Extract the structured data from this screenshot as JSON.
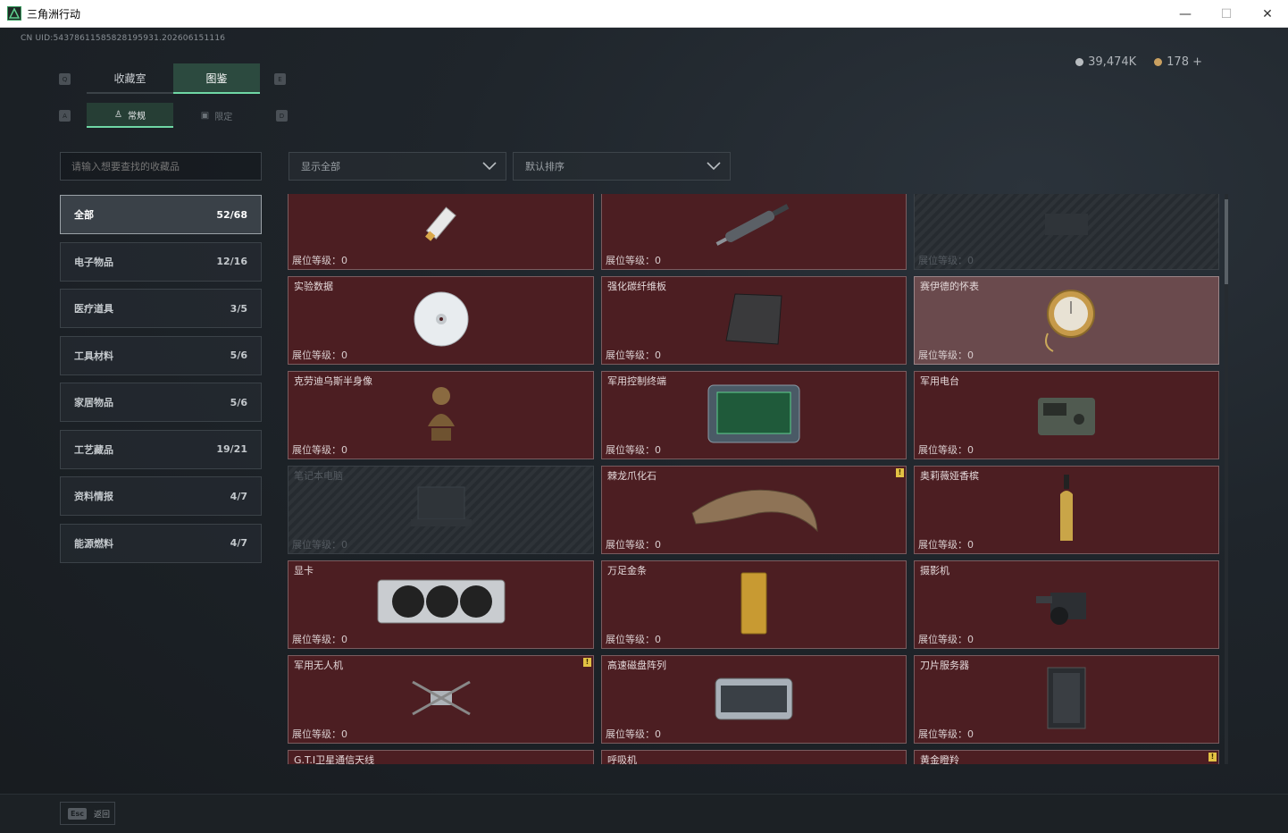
{
  "window": {
    "title": "三角洲行动",
    "minimize": "—",
    "maximize": "☐",
    "close": "✕"
  },
  "uid": "CN UID:543786115858281959​31.202606151116",
  "currency": {
    "money": "39,474K",
    "coins": "178 +"
  },
  "keys": {
    "left_tab": "Q",
    "right_tab": "E",
    "left_sub": "A",
    "right_sub": "D"
  },
  "tabs": [
    {
      "label": "收藏室"
    },
    {
      "label": "图鉴"
    }
  ],
  "subtabs": [
    {
      "label": "常规"
    },
    {
      "label": "限定"
    }
  ],
  "search": {
    "placeholder": "请输入想要查找的收藏品"
  },
  "categories": [
    {
      "label": "全部",
      "count": "52/68"
    },
    {
      "label": "电子物品",
      "count": "12/16"
    },
    {
      "label": "医疗道具",
      "count": "3/5"
    },
    {
      "label": "工具材料",
      "count": "5/6"
    },
    {
      "label": "家居物品",
      "count": "5/6"
    },
    {
      "label": "工艺藏品",
      "count": "19/21"
    },
    {
      "label": "资料情报",
      "count": "4/7"
    },
    {
      "label": "能源燃料",
      "count": "4/7"
    }
  ],
  "filter": {
    "label": "显示全部"
  },
  "sort": {
    "label": "默认排序"
  },
  "level_label": "展位等级：",
  "items": [
    {
      "name": "",
      "level": "0",
      "state": "normal",
      "icon": "usb-stick-icon"
    },
    {
      "name": "",
      "level": "0",
      "state": "normal",
      "icon": "syringe-icon"
    },
    {
      "name": "",
      "level": "0",
      "state": "locked",
      "icon": "locked-item-icon"
    },
    {
      "name": "实验数据",
      "level": "0",
      "state": "normal",
      "icon": "disc-icon"
    },
    {
      "name": "强化碳纤维板",
      "level": "0",
      "state": "normal",
      "icon": "carbon-plate-icon"
    },
    {
      "name": "赛伊德的怀表",
      "level": "0",
      "state": "light",
      "icon": "pocket-watch-icon"
    },
    {
      "name": "克劳迪乌斯半身像",
      "level": "0",
      "state": "normal",
      "icon": "bust-icon"
    },
    {
      "name": "军用控制终端",
      "level": "0",
      "state": "normal",
      "icon": "terminal-icon"
    },
    {
      "name": "军用电台",
      "level": "0",
      "state": "normal",
      "icon": "radio-icon"
    },
    {
      "name": "笔记本电脑",
      "level": "0",
      "state": "locked",
      "icon": "laptop-icon"
    },
    {
      "name": "棘龙爪化石",
      "level": "0",
      "state": "normal",
      "icon": "claw-fossil-icon",
      "badge": "!"
    },
    {
      "name": "奥莉薇娅香槟",
      "level": "0",
      "state": "normal",
      "icon": "champagne-icon"
    },
    {
      "name": "显卡",
      "level": "0",
      "state": "normal",
      "icon": "gpu-icon"
    },
    {
      "name": "万足金条",
      "level": "0",
      "state": "normal",
      "icon": "gold-bar-icon"
    },
    {
      "name": "摄影机",
      "level": "0",
      "state": "normal",
      "icon": "camera-icon"
    },
    {
      "name": "军用无人机",
      "level": "0",
      "state": "normal",
      "icon": "drone-icon",
      "badge": "!"
    },
    {
      "name": "高速磁盘阵列",
      "level": "0",
      "state": "normal",
      "icon": "disk-array-icon"
    },
    {
      "name": "刀片服务器",
      "level": "0",
      "state": "normal",
      "icon": "server-icon"
    },
    {
      "name": "G.T.I卫星通信天线",
      "level": "",
      "state": "normal",
      "icon": "antenna-icon"
    },
    {
      "name": "呼吸机",
      "level": "",
      "state": "normal",
      "icon": "ventilator-icon"
    },
    {
      "name": "黄金瞪羚",
      "level": "",
      "state": "normal",
      "icon": "gazelle-icon",
      "badge": "!"
    }
  ],
  "bottom": {
    "esc_key": "Esc",
    "back_label": "返回"
  },
  "colors": {
    "accent": "#6fd7a5",
    "card_bg": "#4c1e22",
    "badge": "#e2c244"
  }
}
